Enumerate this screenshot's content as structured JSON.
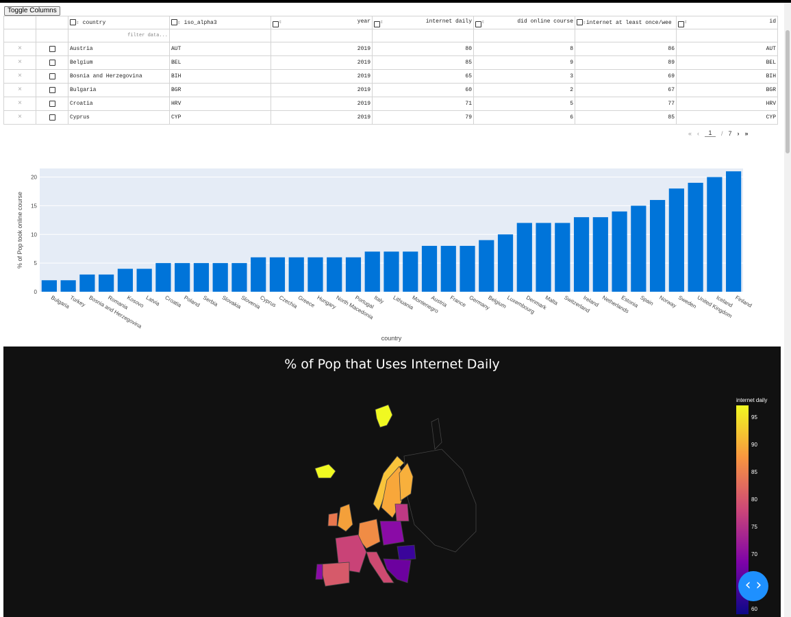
{
  "toolbar": {
    "toggle_columns_label": "Toggle Columns"
  },
  "table": {
    "columns": [
      "country",
      "iso_alpha3",
      "year",
      "internet daily",
      "did online course",
      "internet at least once/wee",
      "id"
    ],
    "filter_placeholder": "filter data...",
    "rows": [
      {
        "country": "Austria",
        "iso": "AUT",
        "year": "2019",
        "daily": "80",
        "course": "8",
        "weekly": "86",
        "id": "AUT"
      },
      {
        "country": "Belgium",
        "iso": "BEL",
        "year": "2019",
        "daily": "85",
        "course": "9",
        "weekly": "89",
        "id": "BEL"
      },
      {
        "country": "Bosnia and Herzegovina",
        "iso": "BIH",
        "year": "2019",
        "daily": "65",
        "course": "3",
        "weekly": "69",
        "id": "BIH"
      },
      {
        "country": "Bulgaria",
        "iso": "BGR",
        "year": "2019",
        "daily": "60",
        "course": "2",
        "weekly": "67",
        "id": "BGR"
      },
      {
        "country": "Croatia",
        "iso": "HRV",
        "year": "2019",
        "daily": "71",
        "course": "5",
        "weekly": "77",
        "id": "HRV"
      },
      {
        "country": "Cyprus",
        "iso": "CYP",
        "year": "2019",
        "daily": "79",
        "course": "6",
        "weekly": "85",
        "id": "CYP"
      }
    ],
    "delete_glyph": "×"
  },
  "pagination": {
    "first": "«",
    "prev": "‹",
    "current": "1",
    "separator": "/",
    "total": "7",
    "next": "›",
    "last": "»"
  },
  "chart_data": [
    {
      "type": "bar",
      "xlabel": "country",
      "ylabel": "% of Pop took online course",
      "ylim": [
        0,
        21.5
      ],
      "yticks": [
        0,
        5,
        10,
        15,
        20
      ],
      "grid": true,
      "bar_color": "#0074d9",
      "plot_bg": "#e5ecf6",
      "categories": [
        "Bulgaria",
        "Turkey",
        "Bosnia and Herzegovina",
        "Romania",
        "Kosovo",
        "Latvia",
        "Croatia",
        "Poland",
        "Serbia",
        "Slovakia",
        "Slovenia",
        "Cyprus",
        "Czechia",
        "Greece",
        "Hungary",
        "North Macedonia",
        "Portugal",
        "Italy",
        "Lithuania",
        "Montenegro",
        "Austria",
        "France",
        "Germany",
        "Belgium",
        "Luxembourg",
        "Denmark",
        "Malta",
        "Switzerland",
        "Ireland",
        "Netherlands",
        "Estonia",
        "Spain",
        "Norway",
        "Sweden",
        "United Kingdom",
        "Iceland",
        "Finland"
      ],
      "values": [
        2,
        2,
        3,
        3,
        4,
        4,
        5,
        5,
        5,
        5,
        5,
        6,
        6,
        6,
        6,
        6,
        6,
        7,
        7,
        7,
        8,
        8,
        8,
        9,
        10,
        12,
        12,
        12,
        13,
        13,
        14,
        15,
        16,
        18,
        19,
        20,
        21
      ]
    },
    {
      "type": "heatmap",
      "title": "% of Pop that Uses Internet Daily",
      "colorbar_title": "internet daily",
      "colorbar_ticks": [
        "95",
        "90",
        "85",
        "80",
        "75",
        "70",
        "60"
      ],
      "colorscale": [
        "#0d0887",
        "#7e03a8",
        "#cc4778",
        "#f89540",
        "#f0f921"
      ]
    }
  ]
}
